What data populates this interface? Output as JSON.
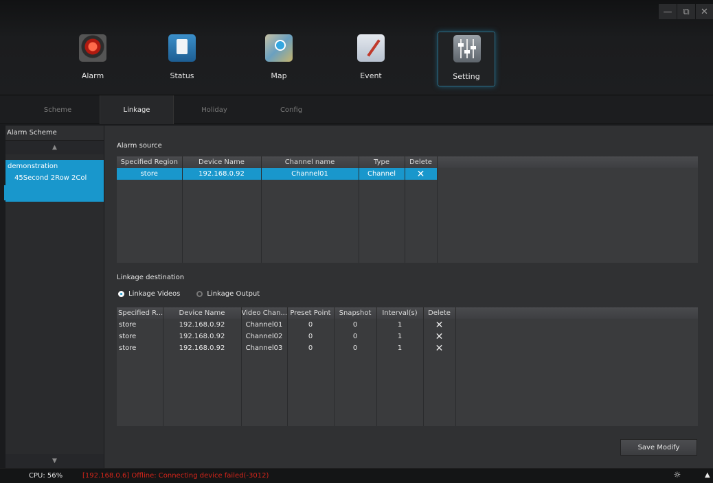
{
  "window": {
    "min": "—",
    "max": "⧉",
    "close": "✕"
  },
  "nav": [
    {
      "label": "Alarm",
      "icon": "alarm-icon"
    },
    {
      "label": "Status",
      "icon": "status-icon"
    },
    {
      "label": "Map",
      "icon": "map-icon"
    },
    {
      "label": "Event",
      "icon": "event-icon"
    },
    {
      "label": "Setting",
      "icon": "setting-icon",
      "active": true
    }
  ],
  "tabs": [
    {
      "label": "Scheme"
    },
    {
      "label": "Linkage",
      "active": true
    },
    {
      "label": "Holiday"
    },
    {
      "label": "Config"
    }
  ],
  "sidebar": {
    "title": "Alarm Scheme",
    "up": "▲",
    "down": "▼",
    "item": {
      "name": "demonstration",
      "sub": "45Second 2Row 2Col"
    }
  },
  "alarm_source": {
    "title": "Alarm source",
    "columns": [
      "Specified Region",
      "Device Name",
      "Channel name",
      "Type",
      "Delete"
    ],
    "rows": [
      {
        "region": "store",
        "device": "192.168.0.92",
        "channel": "Channel01",
        "type": "Channel",
        "delete": "✕"
      }
    ]
  },
  "linkage_destination": {
    "title": "Linkage destination",
    "radio_videos": "Linkage Videos",
    "radio_output": "Linkage Output",
    "selected": "videos",
    "columns": [
      "Specified R...",
      "Device Name",
      "Video Chan...",
      "Preset Point",
      "Snapshot",
      "Interval(s)",
      "Delete"
    ],
    "rows": [
      {
        "region": "store",
        "device": "192.168.0.92",
        "channel": "Channel01",
        "preset": "0",
        "snapshot": "0",
        "interval": "1",
        "delete": "✕"
      },
      {
        "region": "store",
        "device": "192.168.0.92",
        "channel": "Channel02",
        "preset": "0",
        "snapshot": "0",
        "interval": "1",
        "delete": "✕"
      },
      {
        "region": "store",
        "device": "192.168.0.92",
        "channel": "Channel03",
        "preset": "0",
        "snapshot": "0",
        "interval": "1",
        "delete": "✕"
      }
    ]
  },
  "save_label": "Save Modify",
  "status": {
    "cpu": "CPU: 56%",
    "message": "[192.168.0.6] Offline: Connecting device failed(-3012)",
    "light_icon": "☼",
    "up": "▲"
  },
  "colors": {
    "accent": "#1997cc",
    "error": "#d6251a"
  }
}
